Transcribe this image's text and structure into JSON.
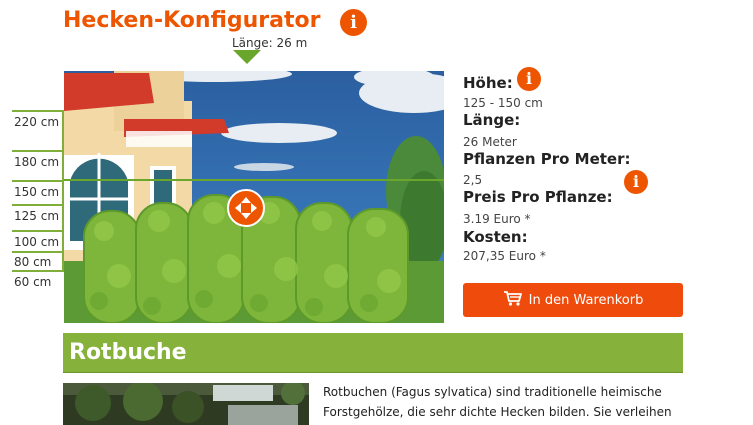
{
  "header": {
    "title": "Hecken-Konfigurator",
    "length_label": "Länge: 26 m"
  },
  "scale": {
    "ticks": [
      "220 cm",
      "180 cm",
      "150 cm",
      "125 cm",
      "100 cm",
      "80 cm",
      "60 cm"
    ]
  },
  "specs": {
    "height_label": "Höhe:",
    "height_value": "125 - 150 cm",
    "length_label": "Länge:",
    "length_value": "26 Meter",
    "plants_label": "Pflanzen Pro Meter:",
    "plants_value": "2,5",
    "price_label": "Preis Pro Pflanze:",
    "price_value": "3.19 Euro *",
    "cost_label": "Kosten:",
    "cost_value": "207,35 Euro *"
  },
  "cart": {
    "button_label": "In den Warenkorb",
    "icon": "cart-icon"
  },
  "product": {
    "name": "Rotbuche",
    "description": "Rotbuchen (Fagus sylvatica) sind traditionelle heimische Forstgehölze, die sehr dichte Hecken bilden. Sie verleihen"
  },
  "icons": {
    "info": "i"
  },
  "colors": {
    "accent": "#ee5500",
    "green": "#86b23c",
    "sky": "#2b5fa0"
  }
}
